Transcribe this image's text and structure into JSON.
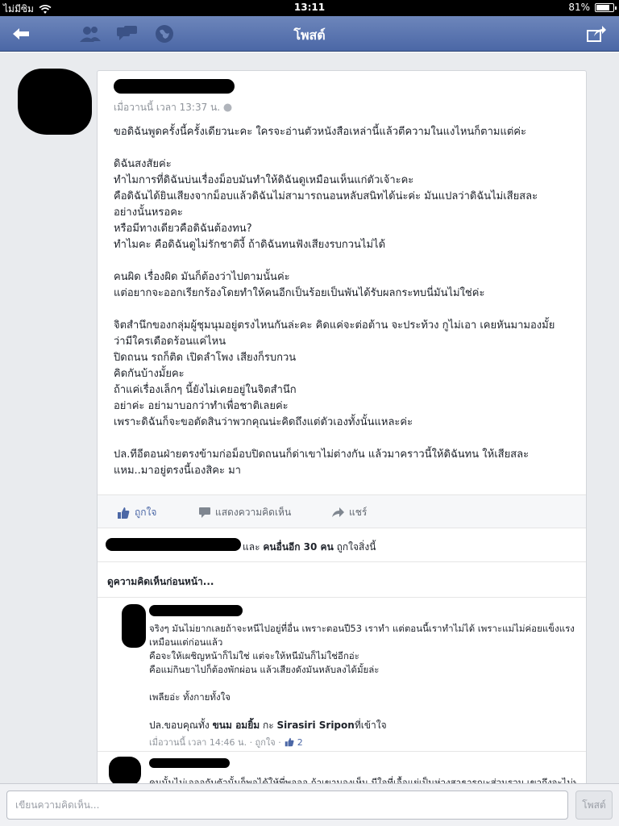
{
  "status_bar": {
    "carrier": "ไม่มีซิม",
    "time": "13:11",
    "battery": "81%",
    "battery_level": 0.81
  },
  "nav": {
    "title": "โพสต์"
  },
  "post": {
    "meta": "เมื่อวานนี้ เวลา 13:37 น.",
    "paragraphs": [
      [
        "ขอดิฉันพูดครั้งนี้ครั้งเดียวนะคะ ใครจะอ่านตัวหนังสือเหล่านี้แล้วตีความในแงไหนก็ตามแต่ค่ะ"
      ],
      [
        "ดิฉันสงสัยค่ะ",
        "ทำไมการที่ดิฉันบ่นเรื่องม็อบมันทำให้ดิฉันดูเหมือนเห็นแก่ตัวเจ้าะคะ",
        "คือดิฉันได้ยินเสียงจากม็อบแล้วดิฉันไม่สามารถนอนหลับสนิทได้น่ะค่ะ มันแปลว่าดิฉันไม่เสียสละ",
        "อย่างนั้นหรอคะ",
        "หรือมีทางเดียวคือดิฉันต้องทน?",
        "ทำไมคะ คือดิฉันดูไม่รักชาติงี้ ถ้าดิฉันทนฟังเสียงรบกวนไม่ได้"
      ],
      [
        "คนผิด เรื่องผิด มันก็ต้องว่าไปตามนั้นค่ะ",
        "แต่อยากจะออกเรียกร้องโดยทำให้คนอีกเป็นร้อยเป็นพันได้รับผลกระทบนี่มันไม่ใช่ค่ะ"
      ],
      [
        "จิตสำนึกของกลุ่มผู้ชุมนุมอยู่ตรงไหนกันล่ะคะ คิดแค่จะต่อต้าน จะประท้วง กูไม่เอา เคยหันมามองมั้ย",
        "ว่ามีใครเดือดร้อนแค่ไหน",
        "ปิดถนน รถก็ติด เปิดลำโพง เสียงก็รบกวน",
        "คิดกันบ้างมั้ยคะ",
        "ถ้าแค่เรื่องเล็กๆ นี้ยังไม่เคยอยู่ในจิตสำนึก",
        "อย่าค่ะ อย่ามาบอกว่าทำเพื่อชาติเลยค่ะ",
        "เพราะดิฉันก็จะขอตัดสินว่าพวกคุณน่ะคิดถึงแต่ตัวเองทั้งนั้นแหละค่ะ"
      ],
      [
        "ปล.ทีอีตอนฝ่ายตรงข้ามก่อม็อบปิดถนนก็ด่าเขาไม่ต่างกัน แล้วมาคราวนี้ให้ดิฉันทน ให้เสียสละ",
        "แหม..มาอยู่ตรงนี้เองสิคะ มา"
      ]
    ]
  },
  "actions": {
    "like": "ถูกใจ",
    "comment": "แสดงความคิดเห็น",
    "share": "แชร์"
  },
  "likes": {
    "prefix": "และ",
    "count_text": "คนอื่นอีก 30 คน",
    "suffix": "ถูกใจสิ่งนี้"
  },
  "prev_comments": "ดูความคิดเห็นก่อนหน้า...",
  "comment1": {
    "lines": [
      "จริงๆ มันไม่ยากเลยถ้าจะหนีไปอยู่ที่อื่น เพราะตอนปี53 เราทำ แต่ตอนนี้เราทำไม่ได้ เพราะแม่ไม่ค่อยแข็งแรง",
      "เหมือนแต่ก่อนแล้ว",
      "คือจะให้เผชิญหน้าก็ไม่ใช่ แต่จะให้หนีมันก็ไม่ใช่อีกอ่ะ",
      "คือแม่กินยาไปก็ต้องพักผ่อน แล้วเสียงดังมันหลับลงได้มั้ยล่ะ",
      "",
      "เพลียอ่ะ ทั้งกายทั้งใจ",
      ""
    ],
    "ps_prefix": "ปล.ขอบคุณทั้ง",
    "ps_name1": "ขนม อมยิ้ม",
    "ps_mid": "กะ",
    "ps_name2": "Sirasiri Sripon",
    "ps_suffix": "ที่เข้าใจ",
    "meta": "เมื่อวานนี้ เวลา 14:46 น. · ถูกใจ ·",
    "like_count": "2"
  },
  "comment2": {
    "partial": "คนนั้นไม่เอออกับตัวนั้นก็พอได้ให้พี่พอออ ถ้าเขามองเห็น มีใจที่เอื้อแย่เป็นห่วงสาธารณะส่วนรวม เขาถึงจะไม่ทำแบบ"
  },
  "composer": {
    "placeholder": "เขียนความคิดเห็น...",
    "post_label": "โพสต์"
  },
  "colors": {
    "nav": "#5872a8",
    "feed_bg": "#e9ebee",
    "link": "#365899",
    "like_icon": "#4b67a6"
  }
}
